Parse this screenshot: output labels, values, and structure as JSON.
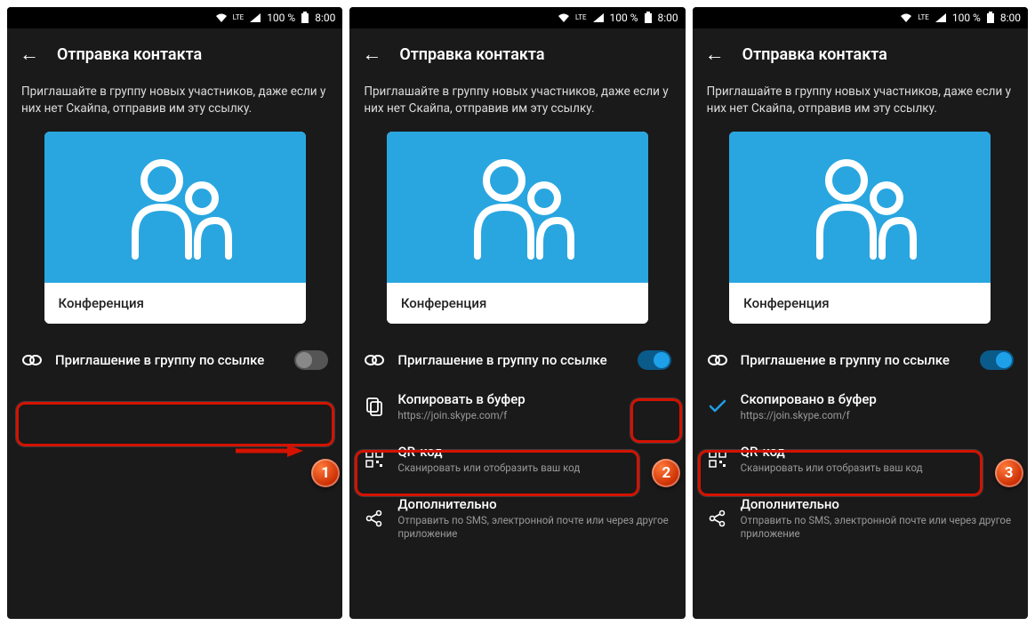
{
  "statusbar": {
    "lte": "LTE",
    "battery_pct": "100 %",
    "time": "8:00"
  },
  "header": {
    "title": "Отправка контакта"
  },
  "intro": "Приглашайте в группу новых участников, даже если у них нет Скайпа, отправив им эту ссылку.",
  "card": {
    "label": "Конференция"
  },
  "rows": {
    "invite": "Приглашение в группу по ссылке",
    "copy": "Копировать в буфер",
    "copied": "Скопировано в буфер",
    "link": "https://join.skype.com/f",
    "qr": "QR-код",
    "qr_sub": "Сканировать или отобразить ваш код",
    "more": "Дополнительно",
    "more_sub": "Отправить по SMS, электронной почте или через другое приложение"
  },
  "steps": {
    "s1": "1",
    "s2": "2",
    "s3": "3"
  }
}
